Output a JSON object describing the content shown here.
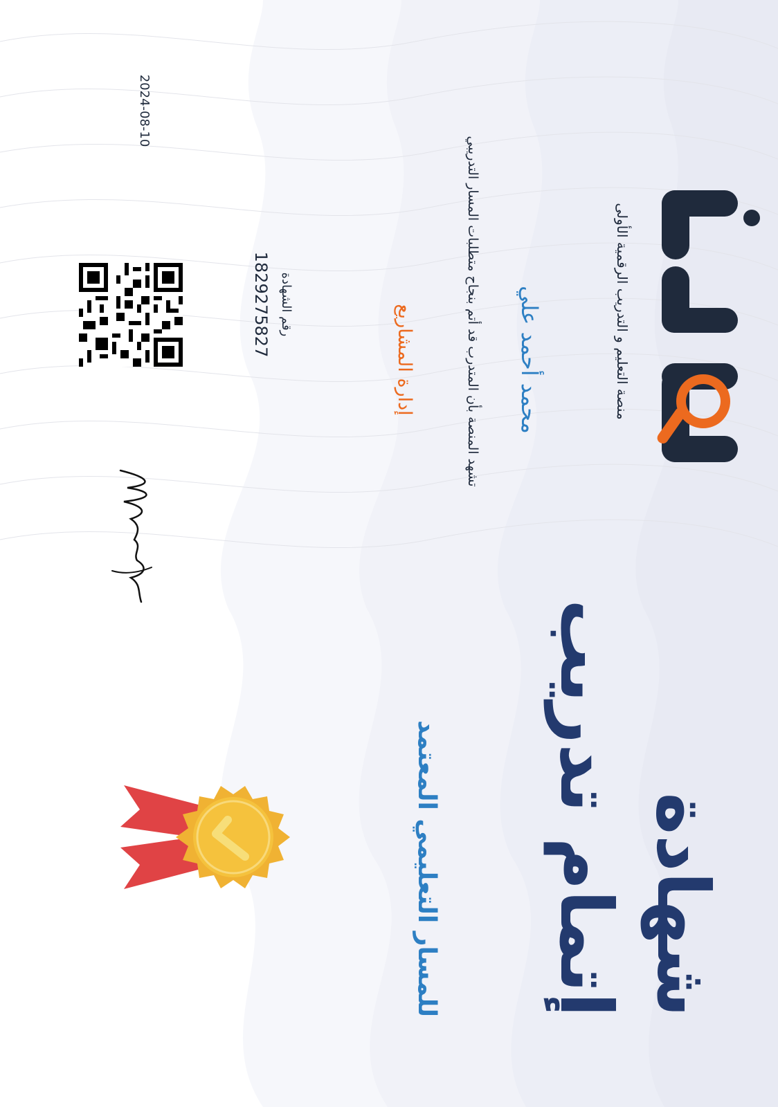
{
  "brand": {
    "name": "مهارة",
    "tagline": "منصة التعليم و التدريب الرقمية الأولى"
  },
  "certificate": {
    "title": "شهادة",
    "subtitle": "إتمام تدريب",
    "purpose": "للمسار التعليمي المعتمد",
    "recipient": "محمد أحمد علي",
    "statement": "تشهد المنصة بأن المتدرب قد أتم بنجاح متطلبات المسار التدريبي",
    "course": "إدارة المشاريع",
    "id_label": "رقم الشهادة",
    "id": "1829275827",
    "date": "2024-08-10"
  },
  "colors": {
    "navy": "#233a6e",
    "blue": "#2d7fc3",
    "orange": "#ec6a1f",
    "dark": "#1f2a3c",
    "medal_gold": "#f2b63c",
    "medal_ribbon": "#e04345"
  },
  "icons": {
    "logo": "magnifier-logo",
    "medal": "award-medal-icon",
    "qr": "qr-code",
    "signature": "signature"
  }
}
